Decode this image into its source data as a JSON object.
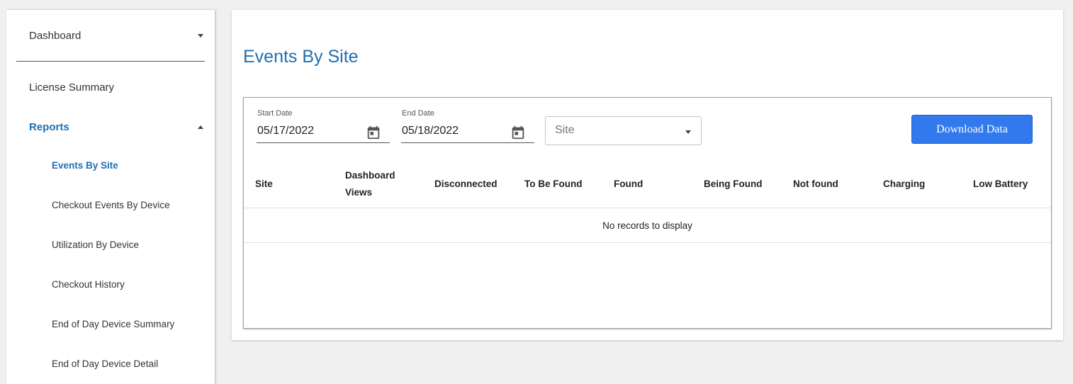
{
  "sidebar": {
    "items": [
      {
        "label": "Dashboard"
      },
      {
        "label": "License Summary"
      },
      {
        "label": "Reports"
      }
    ],
    "reports": [
      "Events By Site",
      "Checkout Events By Device",
      "Utilization By Device",
      "Checkout History",
      "End of Day Device Summary",
      "End of Day Device Detail"
    ]
  },
  "main": {
    "title": "Events By Site",
    "start_date": {
      "label": "Start Date",
      "value": "05/17/2022"
    },
    "end_date": {
      "label": "End Date",
      "value": "05/18/2022"
    },
    "site_select": {
      "label": "Site"
    },
    "download_label": "Download Data",
    "table": {
      "columns": [
        "Site",
        "Dashboard Views",
        "Disconnected",
        "To Be Found",
        "Found",
        "Being Found",
        "Not found",
        "Charging",
        "Low Battery"
      ],
      "empty_message": "No records to display"
    }
  },
  "colors": {
    "accent": "#1f6fb2",
    "button": "#3179ec"
  },
  "icons": [
    "chevron-down-icon",
    "chevron-up-icon",
    "calendar-icon",
    "dropdown-arrow-icon"
  ]
}
